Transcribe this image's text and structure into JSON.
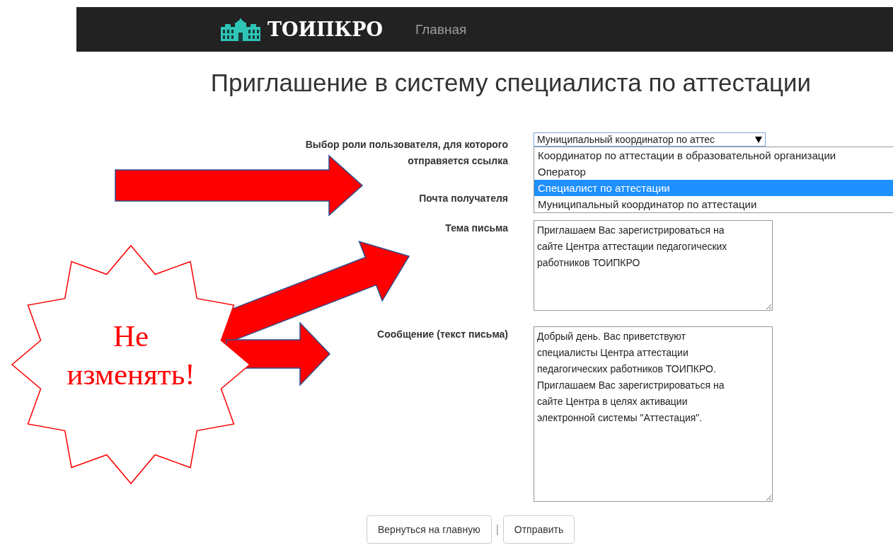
{
  "navbar": {
    "brand": "ТОИПКРО",
    "links": [
      {
        "label": "Главная"
      }
    ]
  },
  "title": "Приглашение в систему специалиста по аттестации",
  "form": {
    "fields": [
      {
        "kind": "select",
        "label": "Выбор роли пользователя, для которого отправяется ссылка",
        "value": "Муниципальный координатор по аттес",
        "expanded": true,
        "options": [
          {
            "label": "Координатор по аттестации в образовательной организации",
            "selected": false
          },
          {
            "label": "Оператор",
            "selected": false
          },
          {
            "label": "Специалист по аттестации",
            "selected": true
          },
          {
            "label": "Муниципальный координатор по аттестации",
            "selected": false
          }
        ]
      },
      {
        "kind": "label",
        "label": "Почта получателя"
      },
      {
        "kind": "textarea",
        "label": "Тема письма",
        "value": "Приглашаем Вас зарегистрироваться на сайте Центра аттестации педагогических работников ТОИПКРО"
      },
      {
        "kind": "textarea",
        "label": "Сообщение (текст письма)",
        "value": "Добрый день. Вас приветствуют специалисты Центра аттестации педагогических работников ТОИПКРО. Приглашаем Вас зарегистрироваться на сайте Центра в целях активации электронной системы \"Аттестация\"."
      }
    ]
  },
  "buttons": [
    "Вернуться на главную",
    "Отправить"
  ],
  "separator": "|",
  "annotation": {
    "text": "Не изменять!"
  }
}
